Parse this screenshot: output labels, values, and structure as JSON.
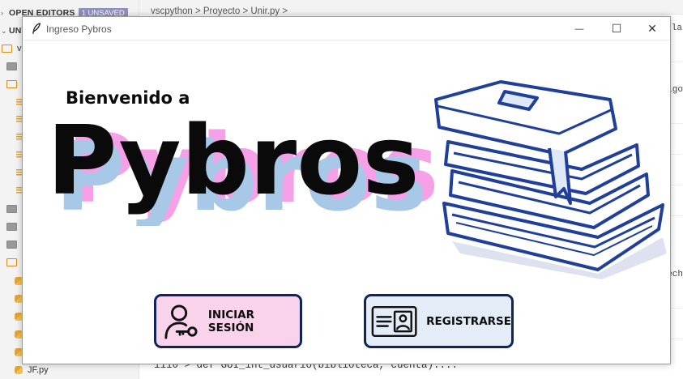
{
  "editor": {
    "explorer_header": "OPEN EDITORS",
    "unsaved_badge": "1 UNSAVED",
    "folder_header": "UNT",
    "folder_letter": "v",
    "visible_file": "JF.py",
    "breadcrumb": "vscpython > Proyecto > Unir.py >",
    "snippet_1": "la",
    "snippet_2": "igo",
    "snippet_3": "ech",
    "bottom_code": "1110   > def GUI_int_usuario(biblioteca, cuenta):..."
  },
  "window": {
    "title": "Ingreso Pybros",
    "controls": {
      "minimize": "—",
      "maximize": "☐",
      "close": "✕"
    }
  },
  "welcome": {
    "greeting": "Bienvenido a",
    "app_name": "Pybros"
  },
  "logo_colors": {
    "main": "#0a0a0a",
    "shadow_pink": "#f6a0e8",
    "shadow_blue": "#a8c8e8",
    "accent_purple": "#c070f0"
  },
  "actions": {
    "login_label": "INICIAR SESIÓN",
    "register_label": "REGISTRARSE"
  },
  "icons": {
    "window": "feather-icon",
    "login": "user-key-icon",
    "register": "id-card-icon",
    "illustration": "stack-of-books-illustration"
  },
  "colors": {
    "button_border": "#10245c",
    "login_bg": "#f9d3ec",
    "register_bg": "#e4ecf8",
    "books_blue": "#1f3f9a"
  }
}
